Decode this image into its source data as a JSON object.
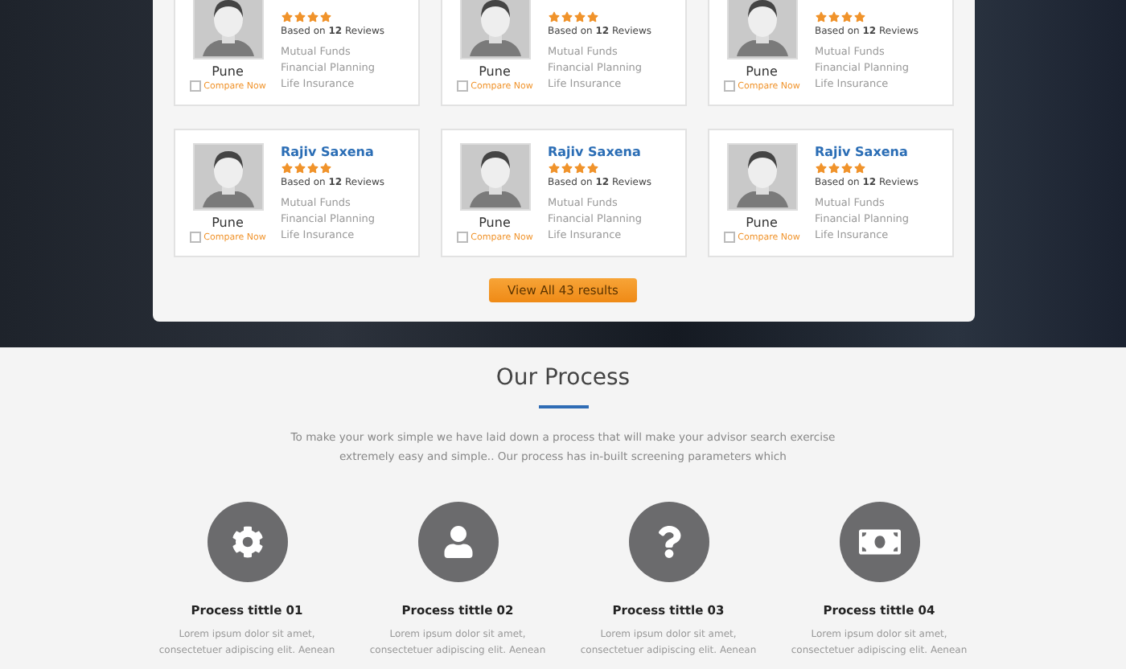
{
  "advisors": [
    {
      "city": "Pune",
      "stars": 4,
      "reviews_prefix": "Based on ",
      "reviews_count": "12",
      "reviews_suffix": " Reviews",
      "specialties": [
        "Mutual Funds",
        "Financial Planning",
        "Life Insurance"
      ],
      "compare": {
        "label": "Compare Now",
        "checked": false
      }
    },
    {
      "city": "Pune",
      "stars": 4,
      "reviews_prefix": "Based on ",
      "reviews_count": "12",
      "reviews_suffix": " Reviews",
      "specialties": [
        "Mutual Funds",
        "Financial Planning",
        "Life Insurance"
      ],
      "compare": {
        "label": "Compare Now",
        "checked": false
      }
    },
    {
      "city": "Pune",
      "stars": 4,
      "reviews_prefix": "Based on ",
      "reviews_count": "12",
      "reviews_suffix": " Reviews",
      "specialties": [
        "Mutual Funds",
        "Financial Planning",
        "Life Insurance"
      ],
      "compare": {
        "label": "Compare Now",
        "checked": false
      }
    },
    {
      "name": "Rajiv Saxena",
      "city": "Pune",
      "stars": 4,
      "reviews_prefix": "Based on ",
      "reviews_count": "12",
      "reviews_suffix": " Reviews",
      "specialties": [
        "Mutual Funds",
        "Financial Planning",
        "Life Insurance"
      ],
      "compare": {
        "label": "Compare Now",
        "checked": false
      }
    },
    {
      "name": "Rajiv Saxena",
      "city": "Pune",
      "stars": 4,
      "reviews_prefix": "Based on ",
      "reviews_count": "12",
      "reviews_suffix": " Reviews",
      "specialties": [
        "Mutual Funds",
        "Financial Planning",
        "Life Insurance"
      ],
      "compare": {
        "label": "Compare Now",
        "checked": false
      }
    },
    {
      "name": "Rajiv Saxena",
      "city": "Pune",
      "stars": 4,
      "reviews_prefix": "Based on ",
      "reviews_count": "12",
      "reviews_suffix": " Reviews",
      "specialties": [
        "Mutual Funds",
        "Financial Planning",
        "Life Insurance"
      ],
      "compare": {
        "label": "Compare Now",
        "checked": false
      }
    }
  ],
  "view_all_button": "View All 43 results",
  "process": {
    "title": "Our Process",
    "intro": "To make your work simple we have laid down a process that will make your advisor search exercise extremely easy and simple.. Our process has in-built screening parameters which",
    "steps": [
      {
        "kind": "gear",
        "title": "Process tittle 01",
        "text": "Lorem ipsum dolor sit amet, consectetuer adipiscing elit. Aenean"
      },
      {
        "kind": "person",
        "title": "Process tittle 02",
        "text": "Lorem ipsum dolor sit amet, consectetuer adipiscing elit. Aenean"
      },
      {
        "kind": "question",
        "title": "Process tittle 03",
        "text": "Lorem ipsum dolor sit amet, consectetuer adipiscing elit. Aenean"
      },
      {
        "kind": "money",
        "title": "Process tittle 04",
        "text": "Lorem ipsum dolor sit amet, consectetuer adipiscing elit. Aenean"
      }
    ]
  }
}
